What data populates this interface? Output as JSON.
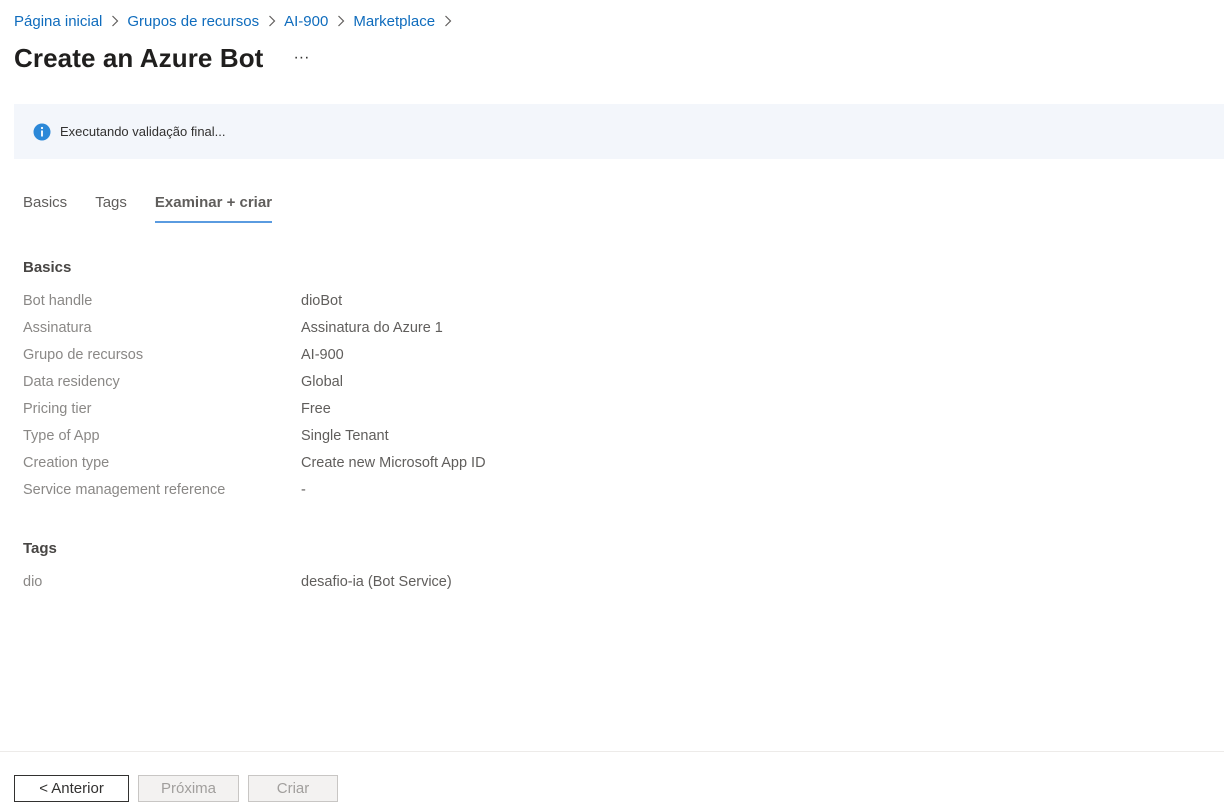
{
  "breadcrumb": [
    {
      "label": "Página inicial"
    },
    {
      "label": "Grupos de recursos"
    },
    {
      "label": "AI-900"
    },
    {
      "label": "Marketplace"
    }
  ],
  "header": {
    "title": "Create an Azure Bot",
    "more_label": "···"
  },
  "info_banner": {
    "icon": "info-icon",
    "text": "Executando validação final...",
    "accent": "#2b88d8",
    "background": "#f3f6fb"
  },
  "tabs": [
    {
      "label": "Basics",
      "active": false
    },
    {
      "label": "Tags",
      "active": false
    },
    {
      "label": "Examinar + criar",
      "active": true
    }
  ],
  "basics": {
    "heading": "Basics",
    "rows": [
      {
        "label": "Bot handle",
        "value": "dioBot"
      },
      {
        "label": "Assinatura",
        "value": "Assinatura do Azure 1"
      },
      {
        "label": "Grupo de recursos",
        "value": "AI-900"
      },
      {
        "label": "Data residency",
        "value": "Global"
      },
      {
        "label": "Pricing tier",
        "value": "Free"
      },
      {
        "label": "Type of App",
        "value": "Single Tenant"
      },
      {
        "label": "Creation type",
        "value": "Create new Microsoft App ID"
      },
      {
        "label": "Service management reference",
        "value": "-"
      }
    ]
  },
  "tags": {
    "heading": "Tags",
    "rows": [
      {
        "label": "dio",
        "value": "desafio-ia (Bot Service)"
      }
    ]
  },
  "footer": {
    "prev_label": "< Anterior",
    "next_label": "Próxima",
    "create_label": "Criar",
    "next_disabled": true,
    "create_disabled": true
  },
  "colors": {
    "link": "#0f6cbd",
    "tab_underline": "#5a9be0"
  }
}
